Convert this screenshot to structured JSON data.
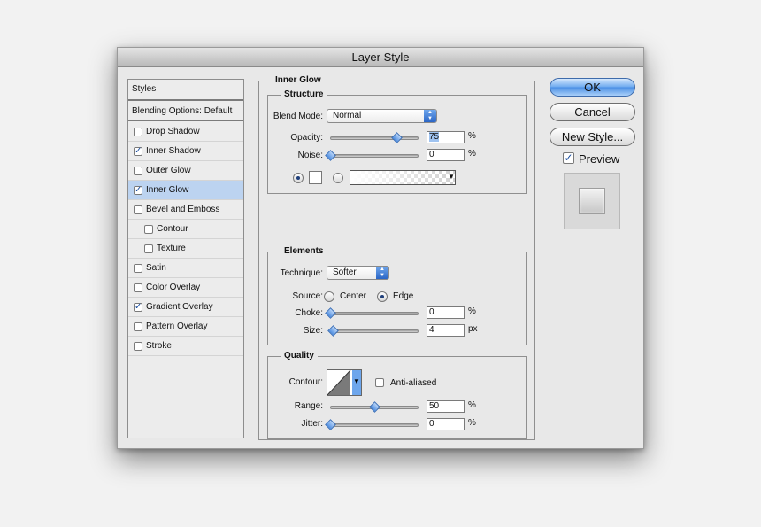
{
  "dialog": {
    "title": "Layer Style"
  },
  "styles_panel": {
    "header": "Styles",
    "blending_options": "Blending Options: Default",
    "items": [
      {
        "label": "Drop Shadow",
        "checked": false,
        "selected": false,
        "indent": false
      },
      {
        "label": "Inner Shadow",
        "checked": true,
        "selected": false,
        "indent": false
      },
      {
        "label": "Outer Glow",
        "checked": false,
        "selected": false,
        "indent": false
      },
      {
        "label": "Inner Glow",
        "checked": true,
        "selected": true,
        "indent": false
      },
      {
        "label": "Bevel and Emboss",
        "checked": false,
        "selected": false,
        "indent": false
      },
      {
        "label": "Contour",
        "checked": false,
        "selected": false,
        "indent": true
      },
      {
        "label": "Texture",
        "checked": false,
        "selected": false,
        "indent": true
      },
      {
        "label": "Satin",
        "checked": false,
        "selected": false,
        "indent": false
      },
      {
        "label": "Color Overlay",
        "checked": false,
        "selected": false,
        "indent": false
      },
      {
        "label": "Gradient Overlay",
        "checked": true,
        "selected": false,
        "indent": false
      },
      {
        "label": "Pattern Overlay",
        "checked": false,
        "selected": false,
        "indent": false
      },
      {
        "label": "Stroke",
        "checked": false,
        "selected": false,
        "indent": false
      }
    ]
  },
  "inner_glow": {
    "title": "Inner Glow",
    "structure": {
      "title": "Structure",
      "blend_mode_label": "Blend Mode:",
      "blend_mode_value": "Normal",
      "opacity_label": "Opacity:",
      "opacity_value": "75",
      "opacity_unit": "%",
      "opacity_fraction": 0.75,
      "noise_label": "Noise:",
      "noise_value": "0",
      "noise_unit": "%",
      "noise_fraction": 0.0
    },
    "elements": {
      "title": "Elements",
      "technique_label": "Technique:",
      "technique_value": "Softer",
      "source_label": "Source:",
      "source_center": "Center",
      "source_edge": "Edge",
      "choke_label": "Choke:",
      "choke_value": "0",
      "choke_unit": "%",
      "choke_fraction": 0.0,
      "size_label": "Size:",
      "size_value": "4",
      "size_unit": "px",
      "size_fraction": 0.03
    },
    "quality": {
      "title": "Quality",
      "contour_label": "Contour:",
      "anti_aliased_label": "Anti-aliased",
      "range_label": "Range:",
      "range_value": "50",
      "range_unit": "%",
      "range_fraction": 0.5,
      "jitter_label": "Jitter:",
      "jitter_value": "0",
      "jitter_unit": "%",
      "jitter_fraction": 0.0
    }
  },
  "buttons": {
    "ok": "OK",
    "cancel": "Cancel",
    "new_style": "New Style...",
    "preview": "Preview"
  },
  "colors": {
    "selection": "#bcd3f0",
    "accent_blue": "#4a8ee4"
  }
}
